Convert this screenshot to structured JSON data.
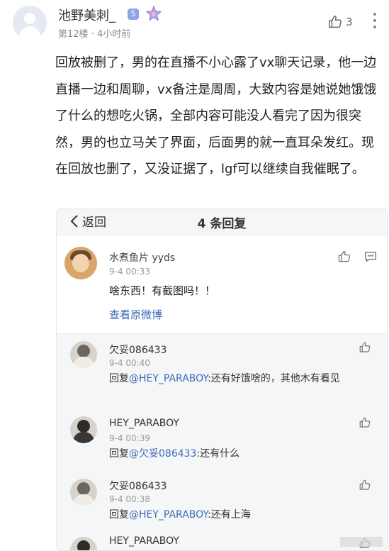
{
  "post": {
    "username": "池野美刺_",
    "level_badge": "5",
    "floor": "第12楼",
    "separator": "·",
    "time": "4小时前",
    "like_count": "3",
    "body": "回放被删了，男的在直播不小心露了vx聊天记录，他一边直播一边和周聊，vx备注是周周，大致内容是她说她饿饿了什么的想吃火锅，全部内容可能没人看完了因为很突然，男的也立马关了界面，后面男的就一直耳朵发红。现在回放也删了，又没证据了，lgf可以继续自我催眠了。"
  },
  "sub_panel": {
    "back_label": "返回",
    "title": "4 条回复",
    "main_comment": {
      "name": "水煮鱼片 yyds",
      "time": "9-4 00:33",
      "text": "啥东西！有截图吗！！",
      "link": "查看原微博"
    },
    "replies": [
      {
        "name": "欠妥086433",
        "time": "9-4 00:40",
        "prefix": "回复",
        "mention": "@HEY_PARABOY",
        "text": ":还有好饿啥的，其他木有看见"
      },
      {
        "name": "HEY_PARABOY",
        "time": "9-4 00:39",
        "prefix": "回复",
        "mention": "@欠妥086433",
        "text": ":还有什么"
      },
      {
        "name": "欠妥086433",
        "time": "9-4 00:38",
        "prefix": "回复",
        "mention": "@HEY_PARABOY",
        "text": ":还有上海"
      },
      {
        "name": "HEY_PARABOY"
      }
    ]
  },
  "colors": {
    "link": "#3b6cb5",
    "meta": "#8a8a8a",
    "panel_bg": "#f5f6f8"
  },
  "icons": [
    "thumb-up-icon",
    "more-icon",
    "back-chevron-icon",
    "comment-icon",
    "verified-badge-icon",
    "star-badge-icon"
  ]
}
